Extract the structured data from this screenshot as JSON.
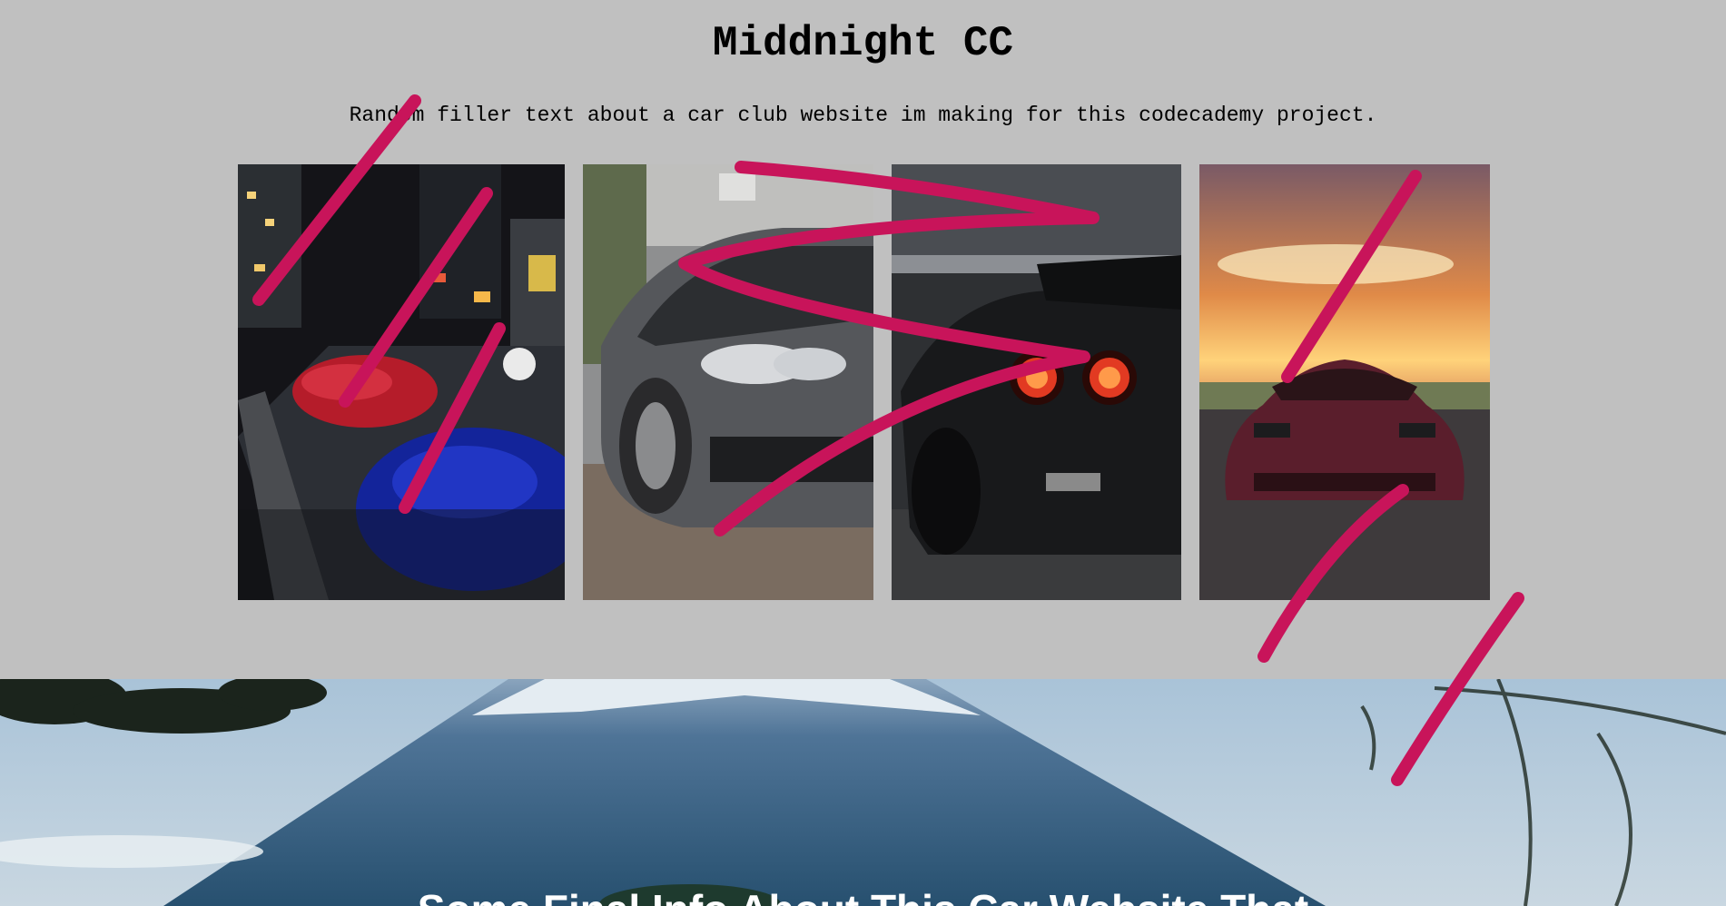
{
  "header": {
    "title": "Middnight CC",
    "subtitle": "Random filler text about a car club website im making for this codecademy project."
  },
  "gallery": {
    "photos": [
      {
        "name": "night-street-skylines-photo"
      },
      {
        "name": "grey-widebody-sedan-photo"
      },
      {
        "name": "black-skyline-taillights-photo"
      },
      {
        "name": "maroon-coupe-sunset-photo"
      }
    ]
  },
  "hero": {
    "heading": "Some Final Info About This Car Website That"
  },
  "colors": {
    "page_background": "#c0c0c0",
    "scribble": "#c8145a",
    "heading_text": "#ffffff"
  }
}
